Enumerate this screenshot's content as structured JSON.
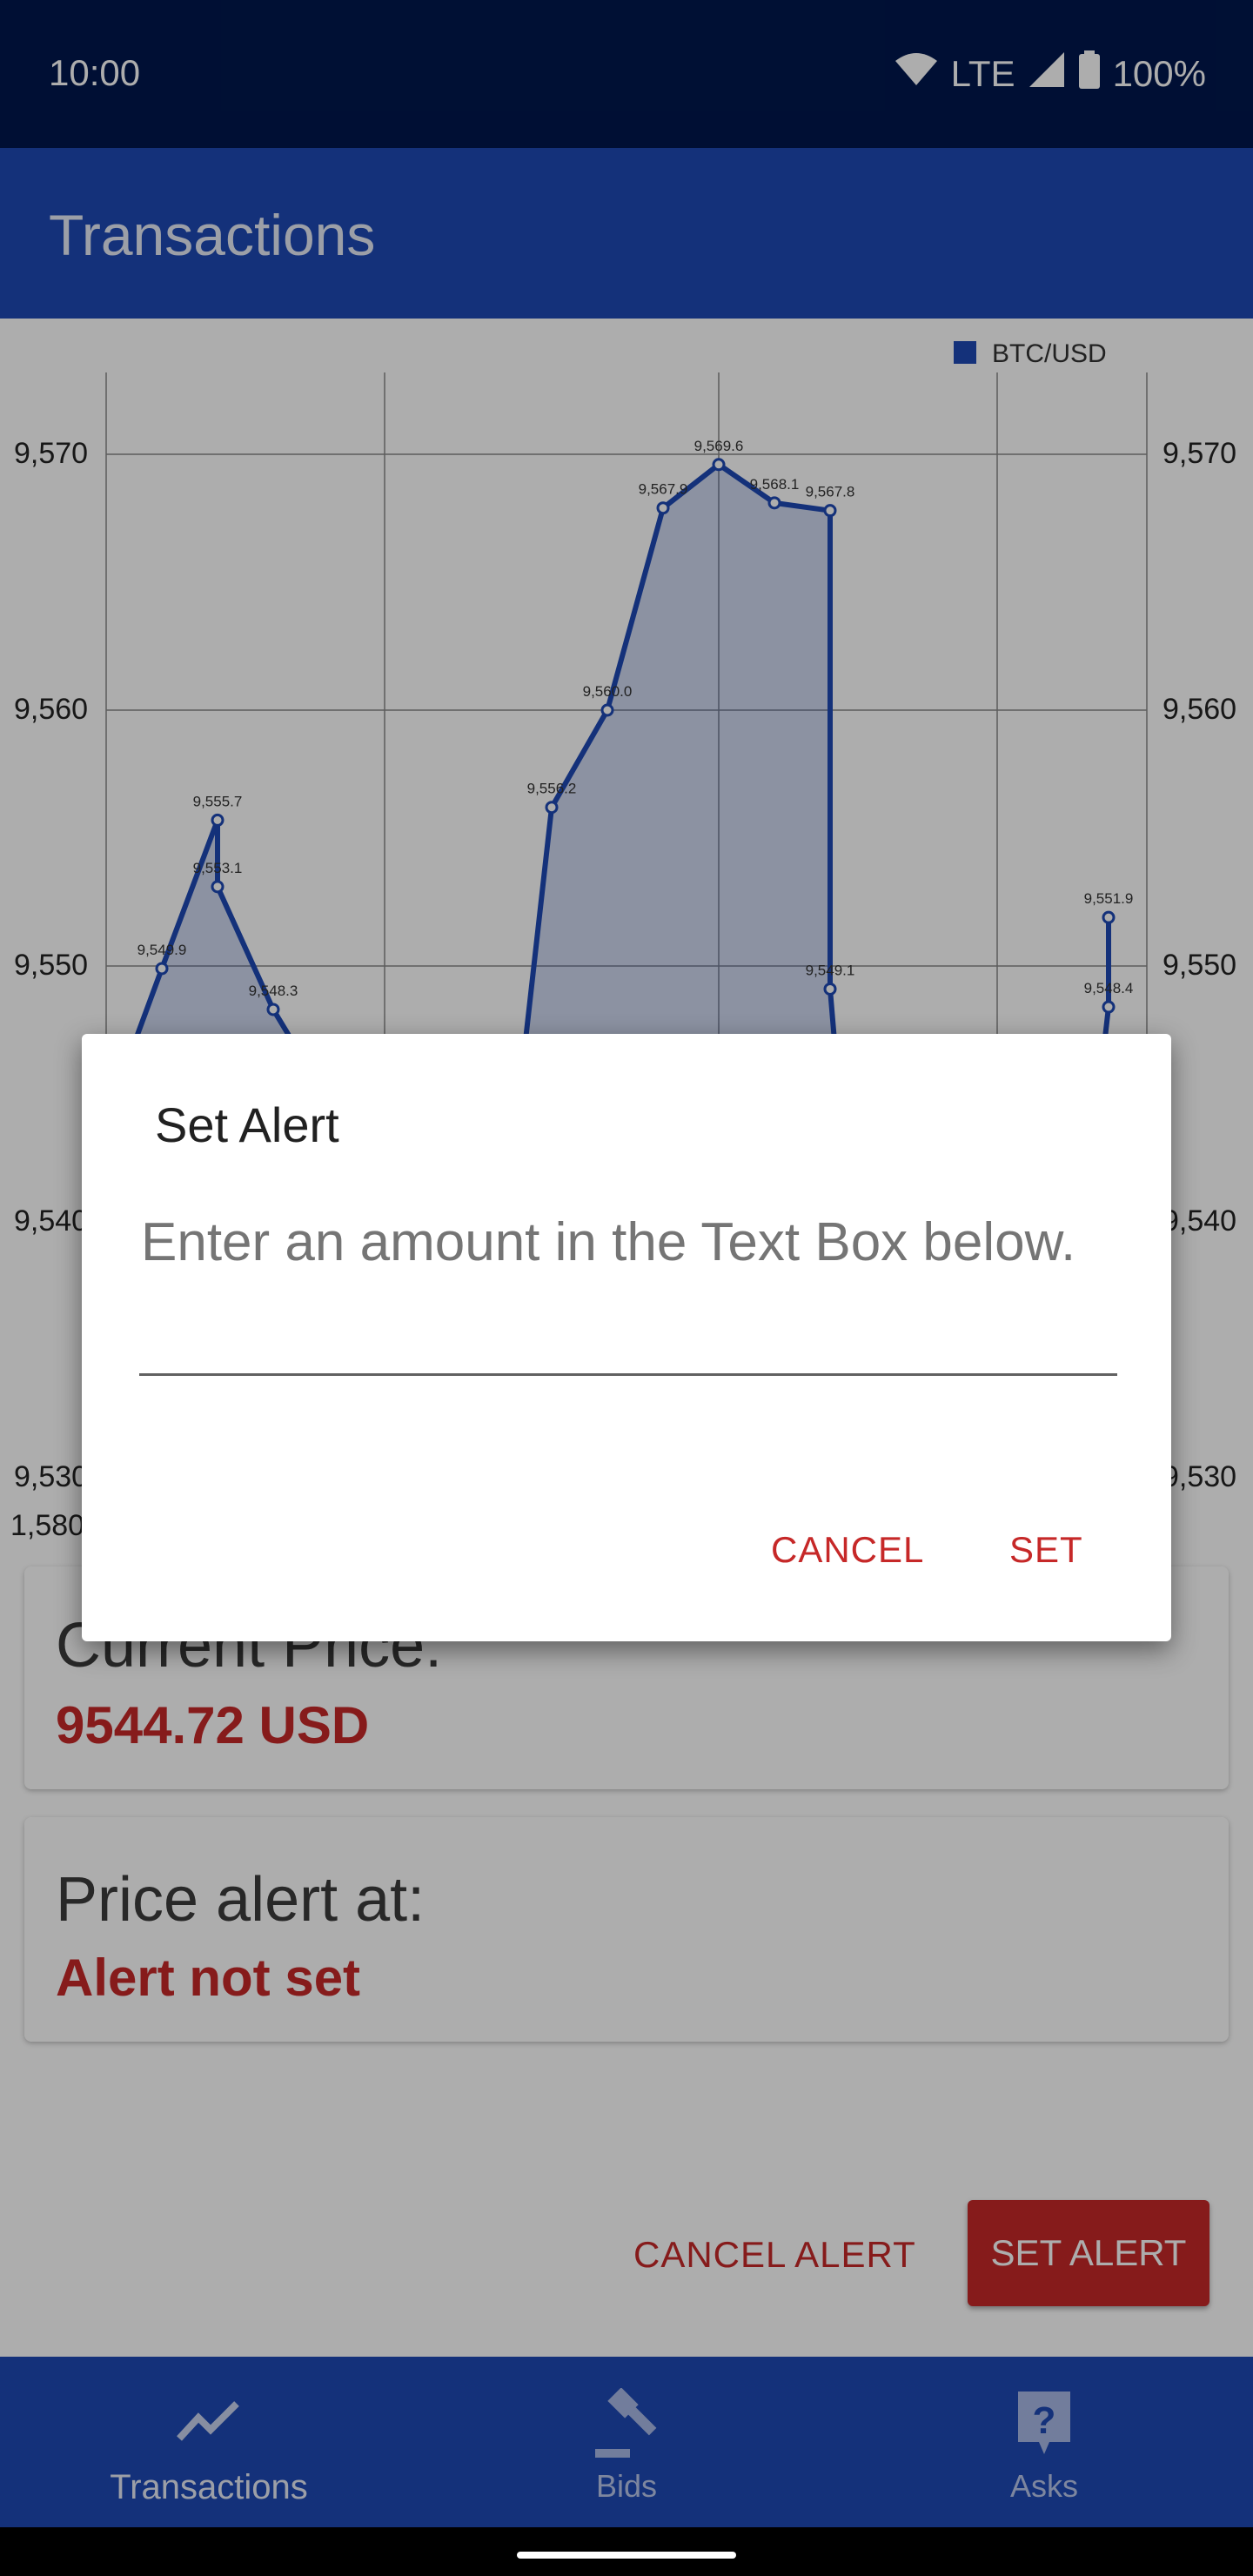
{
  "status_bar": {
    "time": "10:00",
    "network": "LTE",
    "battery": "100%"
  },
  "app_bar": {
    "title": "Transactions"
  },
  "chart_data": {
    "type": "line",
    "series": [
      {
        "name": "BTC/USD",
        "color": "#1e49b4",
        "points": [
          {
            "x": 0,
            "y": 9544.0,
            "label": ""
          },
          {
            "x": 1,
            "y": 9549.9,
            "label": "9,549.9"
          },
          {
            "x": 2,
            "y": 9555.7,
            "label": "9,555.7"
          },
          {
            "x": 2,
            "y": 9553.1,
            "label": "9,553.1"
          },
          {
            "x": 3,
            "y": 9548.3,
            "label": "9,548.3"
          },
          {
            "x": 3.5,
            "y": 9546.5,
            "label": ""
          },
          {
            "x": 7.5,
            "y": 9546.5,
            "label": ""
          },
          {
            "x": 8,
            "y": 9556.2,
            "label": "9,556.2"
          },
          {
            "x": 9,
            "y": 9560.0,
            "label": "9,560.0"
          },
          {
            "x": 10,
            "y": 9567.9,
            "label": "9,567.9"
          },
          {
            "x": 11,
            "y": 9569.6,
            "label": "9,569.6"
          },
          {
            "x": 12,
            "y": 9568.1,
            "label": "9,568.1"
          },
          {
            "x": 13,
            "y": 9567.8,
            "label": "9,567.8"
          },
          {
            "x": 13,
            "y": 9549.1,
            "label": "9,549.1"
          },
          {
            "x": 13.1,
            "y": 9546.5,
            "label": ""
          },
          {
            "x": 17.9,
            "y": 9546.5,
            "label": ""
          },
          {
            "x": 18,
            "y": 9548.4,
            "label": "9,548.4"
          },
          {
            "x": 18,
            "y": 9551.9,
            "label": "9,551.9"
          }
        ]
      }
    ],
    "y_ticks": [
      "9,570",
      "9,560",
      "9,550",
      "9,540",
      "9,530"
    ],
    "y_ticks_right": [
      "9,570",
      "9,560",
      "9,550",
      "9,540",
      "9,530"
    ],
    "y_values": [
      9570,
      9560,
      9550,
      9540,
      9530
    ],
    "x_tick_partial": "1,580",
    "legend": {
      "label": "BTC/USD",
      "position": "top-right"
    },
    "grid": true
  },
  "cards": {
    "current_price": {
      "label": "Current Price:",
      "value": "9544.72 USD"
    },
    "price_alert": {
      "label": "Price alert at:",
      "value": "Alert not set"
    }
  },
  "actions": {
    "cancel_alert": "CANCEL ALERT",
    "set_alert": "SET ALERT"
  },
  "bottom_nav": [
    {
      "label": "Transactions",
      "icon": "trending-icon"
    },
    {
      "label": "Bids",
      "icon": "gavel-icon"
    },
    {
      "label": "Asks",
      "icon": "help-icon"
    }
  ],
  "dialog": {
    "title": "Set Alert",
    "message": "Enter an amount in the Text Box below.",
    "input_value": "",
    "cancel_label": "CANCEL",
    "set_label": "SET"
  },
  "colors": {
    "accent": "#c62828",
    "primary": "#1e49b4",
    "status": "#00174d"
  }
}
